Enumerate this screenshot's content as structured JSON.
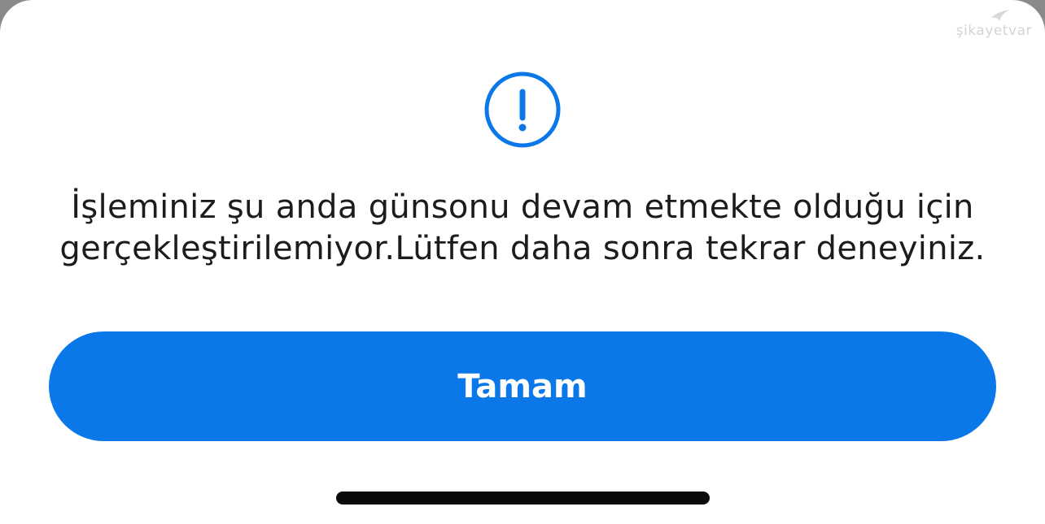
{
  "watermark": {
    "text": "şikayetvar",
    "icon": "bird-logo-icon"
  },
  "dialog": {
    "icon": "exclamation-circle-icon",
    "accent_color": "#0a78e9",
    "message_line1": "İşleminiz şu anda günsonu devam etmekte olduğu için",
    "message_line2": "gerçekleştirilemiyor.Lütfen daha sonra tekrar deneyiniz.",
    "button_label": "Tamam"
  }
}
